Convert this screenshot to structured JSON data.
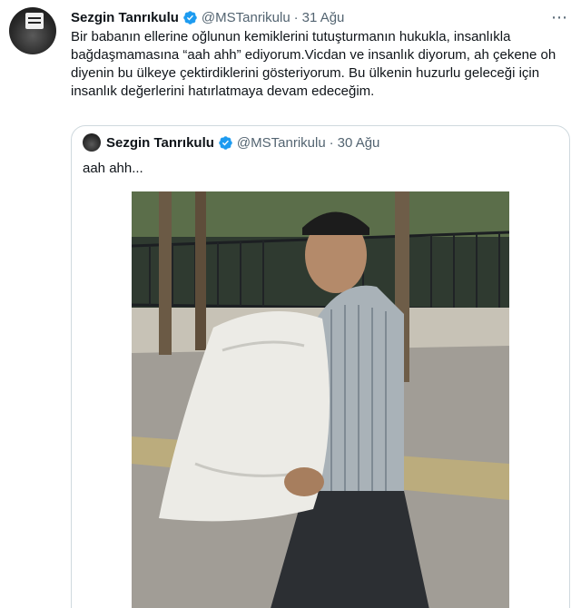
{
  "tweet": {
    "author_name": "Sezgin Tanrıkulu",
    "handle": "@MSTanrikulu",
    "separator": "·",
    "date": "31 Ağu",
    "more_icon": "⋯",
    "text": "Bir babanın ellerine oğlunun kemiklerini tutuşturmanın hukukla, insanlıkla bağdaşmamasına “aah ahh” ediyorum.Vicdan ve insanlık diyorum, ah çekene oh diyenin bu ülkeye çektirdiklerini gösteriyorum. Bu ülkenin huzurlu geleceği için insanlık değerlerini hatırlatmaya devam edeceğim."
  },
  "quoted_tweet": {
    "author_name": "Sezgin Tanrıkulu",
    "handle": "@MSTanrikulu",
    "separator": "·",
    "date": "30 Ağu",
    "text": "aah ahh..."
  },
  "icons": {
    "verified": "verified-badge-icon",
    "more": "more-options-icon"
  },
  "colors": {
    "verified_blue": "#1d9bf0",
    "secondary_text": "#536471",
    "border": "#cfd9de"
  }
}
